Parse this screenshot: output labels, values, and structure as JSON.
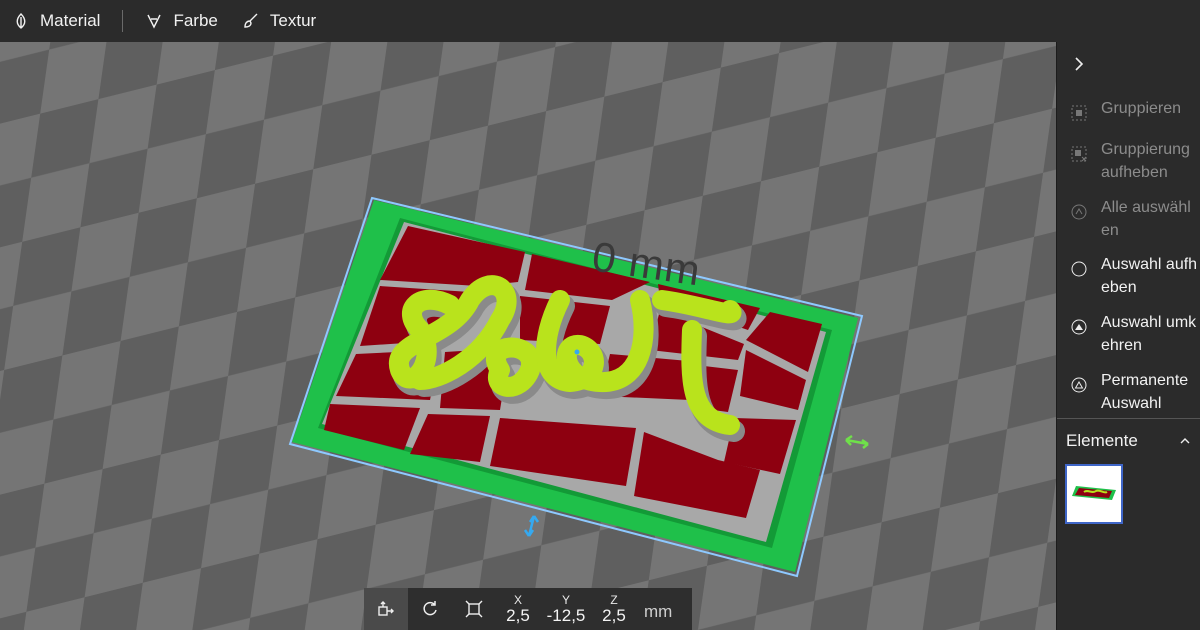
{
  "toolbar": {
    "material_label": "Material",
    "farbe_label": "Farbe",
    "textur_label": "Textur"
  },
  "viewport": {
    "dimension_label": "0 mm",
    "model_text": "Doli",
    "colors": {
      "base_green": "#1fc04a",
      "red_tiles": "#8e0010",
      "grout_gray": "#a8a8a8",
      "lettering": "#b9e31c",
      "selection_outline": "#8ec9ff"
    }
  },
  "transform_bar": {
    "x_axis": "X",
    "x_value": "2,5",
    "y_axis": "Y",
    "y_value": "-12,5",
    "z_axis": "Z",
    "z_value": "2,5",
    "unit": "mm"
  },
  "panel": {
    "items": [
      {
        "label": "Gruppieren",
        "enabled": false,
        "icon": "group-icon"
      },
      {
        "label": "Gruppierung aufheben",
        "enabled": false,
        "icon": "ungroup-icon"
      },
      {
        "label": "Alle auswählen",
        "enabled": false,
        "icon": "select-all-icon"
      },
      {
        "label": "Auswahl aufheben",
        "enabled": true,
        "icon": "deselect-icon"
      },
      {
        "label": "Auswahl umkehren",
        "enabled": true,
        "icon": "invert-selection-icon"
      },
      {
        "label": "Permanente Auswahl",
        "enabled": true,
        "icon": "permanent-selection-icon"
      }
    ],
    "elements_label": "Elemente"
  }
}
